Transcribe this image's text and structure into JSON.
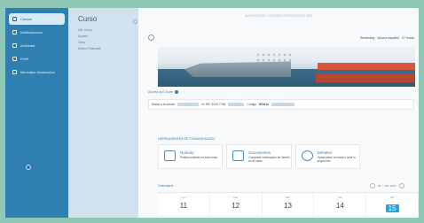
{
  "nav": {
    "items": [
      {
        "label": "Cursos",
        "active": true
      },
      {
        "label": "Notificaciones",
        "active": false
      },
      {
        "label": "Actividad",
        "active": false
      },
      {
        "label": "Perfil",
        "active": false
      },
      {
        "label": "Mensajes destacados",
        "active": false
      }
    ]
  },
  "course": {
    "title": "Curso",
    "links": [
      "Info. Curso",
      "Usuario",
      "Tema",
      "Sesión Presencial"
    ]
  },
  "main": {
    "topbar_text": "UNIVERSITARIO: SESIONES PRESENCIALES 2023",
    "meta": "Streaming · Idioma español · 27 horas",
    "access": {
      "label": "Acceso por Zoom",
      "enter_text": "Entrar a la sesión",
      "id_text": "ID 997 3243 7766",
      "code_label": "Código",
      "code_value": "EDA1s"
    },
    "share": {
      "label": "HERRAMIENTAS DE COMUNICACIÓN",
      "cards": [
        {
          "title": "Noticias",
          "desc": "Publica noticias en este curso"
        },
        {
          "title": "Documentos",
          "desc": "Comparte información de interés en el curso"
        },
        {
          "title": "Debates",
          "desc": "Opina sobre un tema o crea tu propio hilo"
        }
      ]
    },
    "calendar": {
      "label": "Calendario",
      "range": "05 — 09 / 2023",
      "days": [
        {
          "name": "Lun",
          "num": "11",
          "today": false
        },
        {
          "name": "Mar",
          "num": "12",
          "today": false
        },
        {
          "name": "Mié",
          "num": "13",
          "today": false
        },
        {
          "name": "Jue",
          "num": "14",
          "today": false
        },
        {
          "name": "Vie",
          "num": "15",
          "today": true
        }
      ]
    }
  }
}
